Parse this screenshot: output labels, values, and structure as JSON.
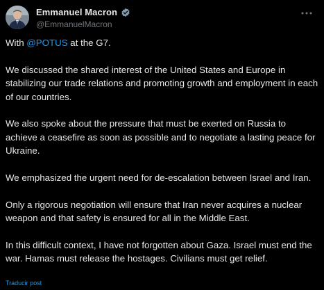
{
  "author": {
    "display_name": "Emmanuel Macron",
    "handle": "@EmmanuelMacron",
    "verified": true
  },
  "post": {
    "intro_prefix": "With ",
    "intro_mention": "@POTUS",
    "intro_suffix": " at the G7.",
    "paragraphs": [
      "We discussed the shared interest of the United States and Europe in stabilizing our trade relations and promoting growth and employment in each of our countries.",
      "We also spoke about the pressure that must be exerted on Russia to achieve a ceasefire as soon as possible and to negotiate a lasting peace for Ukraine.",
      "We emphasized the urgent need for de-escalation between Israel and Iran.",
      "Only a rigorous negotiation will ensure that Iran never acquires a nuclear weapon and that safety is ensured for all in the Middle East.",
      "In this difficult context, I have not forgotten about Gaza. Israel must end the war. Hamas must release the hostages. Civilians must get relief."
    ]
  },
  "actions": {
    "translate_label": "Traducir post"
  },
  "icons": {
    "verified": "verified-badge-icon",
    "more": "more-options-icon"
  },
  "colors": {
    "background": "#000000",
    "text": "#e7e9ea",
    "secondary_text": "#71767b",
    "accent": "#1d9bf0"
  }
}
